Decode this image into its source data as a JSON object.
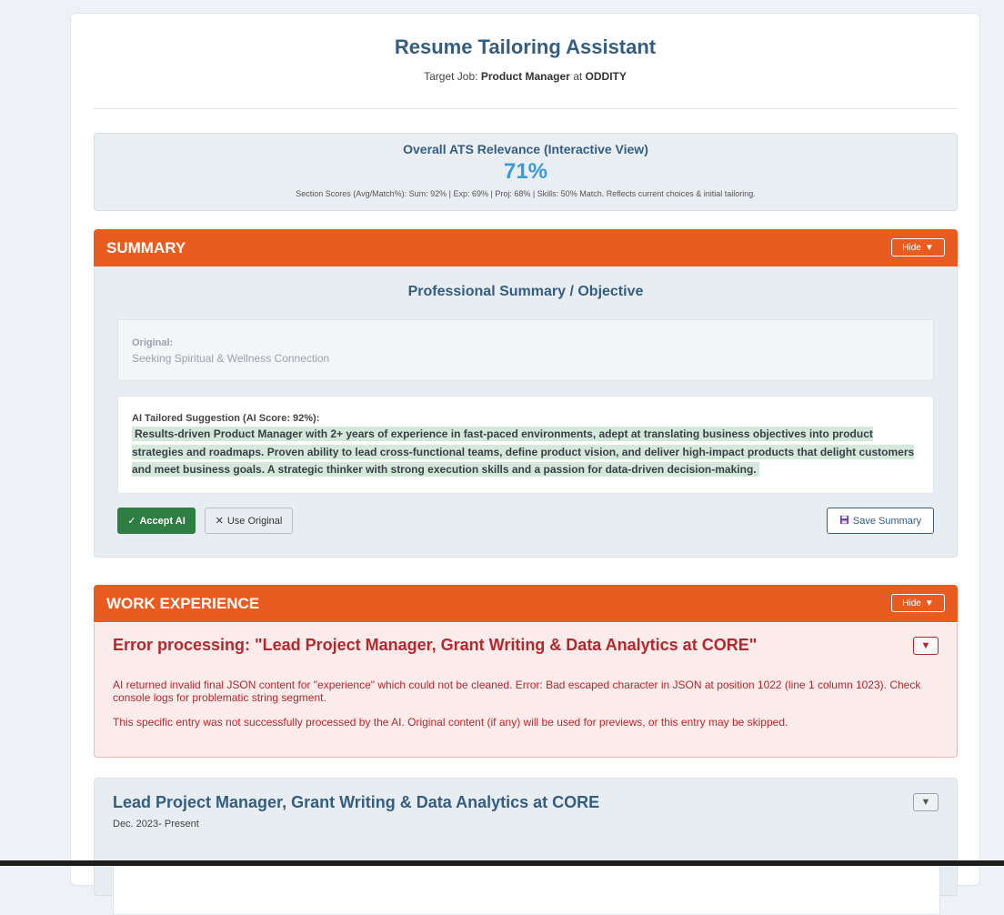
{
  "header": {
    "title": "Resume Tailoring Assistant",
    "target_prefix": "Target Job:",
    "target_role": "Product Manager",
    "target_at": "at",
    "target_company": "ODDITY"
  },
  "ats": {
    "title": "Overall ATS Relevance (Interactive View)",
    "percent": "71%",
    "details": "Section Scores (Avg/Match%): Sum: 92% | Exp: 69% | Proj: 68% | Skills: 50% Match. Reflects current choices & initial tailoring."
  },
  "summary_section": {
    "header": "SUMMARY",
    "hide_label": "Hide",
    "subtitle": "Professional Summary / Objective",
    "original_label": "Original:",
    "original_text": "Seeking Spiritual & Wellness Connection",
    "ai_label": "AI Tailored Suggestion (AI Score: 92%):",
    "ai_text": "Results-driven Product Manager with 2+ years of experience in fast-paced environments, adept at translating business objectives into product strategies and roadmaps. Proven ability to lead cross-functional teams, define product vision, and deliver high-impact products that delight customers and meet business goals. A strategic thinker with strong execution skills and a passion for data-driven decision-making.",
    "accept_label": "Accept AI",
    "use_original_label": "Use Original",
    "save_label": "Save Summary"
  },
  "experience_section": {
    "header": "WORK EXPERIENCE",
    "hide_label": "Hide",
    "error": {
      "title": "Error processing: \"Lead Project Manager, Grant Writing & Data Analytics at CORE\"",
      "message": "AI returned invalid final JSON content for \"experience\" which could not be cleaned. Error: Bad escaped character in JSON at position 1022 (line 1 column 1023). Check console logs for problematic string segment.",
      "message2": "This specific entry was not successfully processed by the AI. Original content (if any) will be used for previews, or this entry may be skipped."
    },
    "entry": {
      "title": "Lead Project Manager, Grant Writing & Data Analytics at CORE",
      "dates": "Dec. 2023- Present"
    }
  },
  "colors": {
    "accent": "#ea5b1f",
    "heading": "#345d82",
    "percent": "#3a9ad9",
    "accept": "#2e7d43",
    "error": "#b3282d"
  },
  "icons": {
    "triangle_down": "▼",
    "check": "✓",
    "x": "✕",
    "save": "💾"
  }
}
